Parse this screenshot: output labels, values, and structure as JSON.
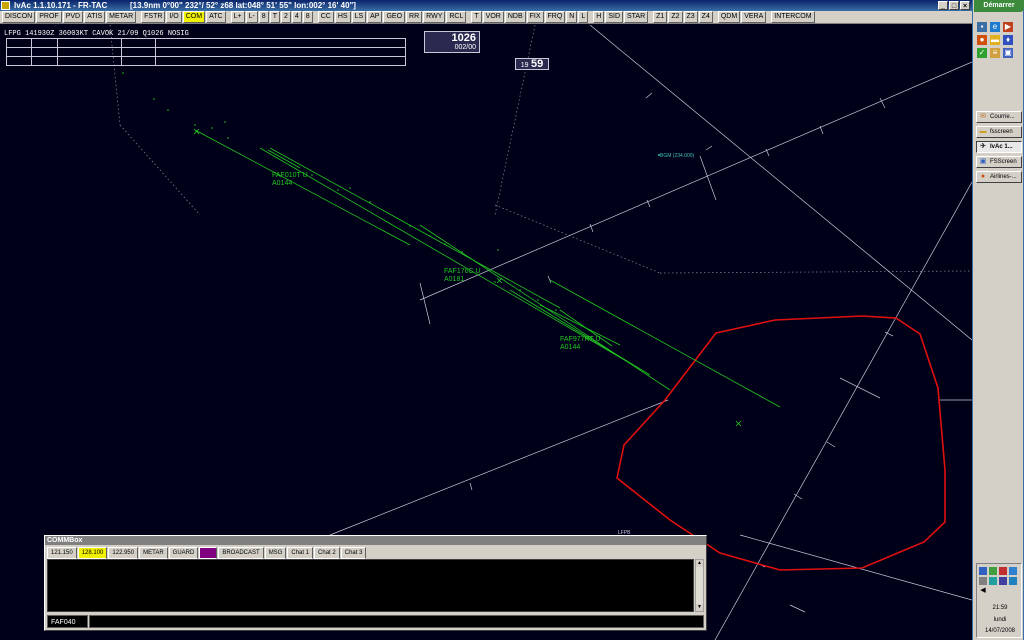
{
  "window": {
    "title": "IvAc 1.1.10.171 - FR-TAC",
    "status": "[13.9nm  0°00\"  232°/ 52°  z68  lat:048° 51' 55\" lon:002° 16' 40\"]",
    "controls": [
      "_",
      "□",
      "×"
    ]
  },
  "toolbar": {
    "buttons": [
      "DISCON",
      "PROF",
      "PVD",
      "ATIS",
      "METAR",
      "FSTR",
      "I/O",
      "COM",
      "ATC",
      "L+",
      "L-",
      "8",
      "T",
      "2",
      "4",
      "8",
      "CC",
      "HS",
      "LS",
      "AP",
      "GEO",
      "RR",
      "RWY",
      "RCL",
      "T",
      "VOR",
      "NDB",
      "FIX",
      "FRQ",
      "N",
      "L",
      "H",
      "SID",
      "STAR",
      "Z1",
      "Z2",
      "Z3",
      "Z4",
      "QDM",
      "VERA",
      "INTERCOM"
    ],
    "active": [
      "COM"
    ]
  },
  "scope": {
    "metar": "LFPG 141930Z 36003KT CAVOK 21/09 Q1026 NOSIG",
    "qnh_value": "1026",
    "wind_value": "002/00",
    "clock_hour": "19",
    "clock_min": "59",
    "fix_label": "BGM (234.000)",
    "small_label": "LFPB",
    "targets": [
      {
        "callsign": "FAF010T U",
        "alt": "A0144"
      },
      {
        "callsign": "FAF176C U",
        "alt": "A0181"
      },
      {
        "callsign": "FAF977RT U",
        "alt": "A0144"
      }
    ],
    "colors": {
      "background": "#000018",
      "target": "#22c722",
      "sector": "#e01010",
      "lines": "#c8c8d8",
      "fix": "#3fc0b0"
    }
  },
  "commbox": {
    "title": "COMMBox",
    "tabs": [
      "121.150",
      "128.100",
      "122.950",
      "METAR",
      "GUARD",
      "",
      "BROADCAST",
      "MSG",
      "Chat 1",
      "Chat 2",
      "Chat 3"
    ],
    "active_tab": "128.100",
    "frequency_field": "FAF040",
    "input_value": ""
  },
  "taskbar": {
    "start_label": "Démarrer",
    "tasks": [
      {
        "label": "Courrie...",
        "icon": "mail-icon"
      },
      {
        "label": "fsscreen",
        "icon": "folder-icon"
      },
      {
        "label": "IvAc 1...",
        "icon": "ivac-icon"
      },
      {
        "label": "FSScreen",
        "icon": "app-icon"
      },
      {
        "label": "Airlines-...",
        "icon": "firefox-icon"
      }
    ],
    "active_task": "IvAc 1...",
    "time": "21:59",
    "day": "lundi",
    "date": "14/07/2008"
  }
}
